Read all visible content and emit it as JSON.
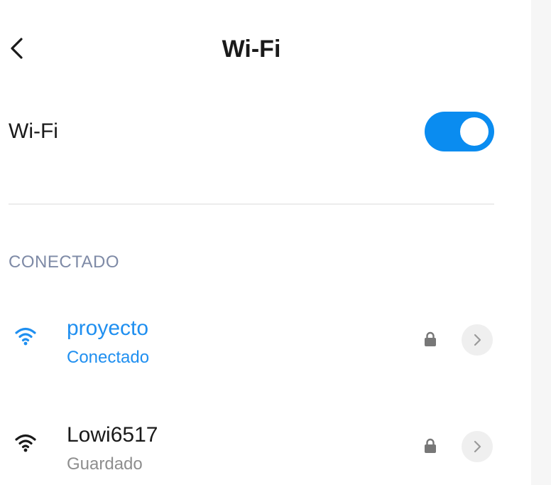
{
  "header": {
    "title": "Wi-Fi",
    "back_icon": "chevron-left-icon"
  },
  "wifi_toggle": {
    "label": "Wi-Fi",
    "enabled": true,
    "accent_color": "#0a8cf0"
  },
  "connected_section": {
    "header": "CONECTADO"
  },
  "networks": [
    {
      "name": "proyecto",
      "status": "Conectado",
      "secured": true,
      "color": "#1f8ff0",
      "signal_icon": "wifi-signal-icon",
      "lock_icon": "lock-icon",
      "detail_icon": "chevron-right-icon"
    },
    {
      "name": "Lowi6517",
      "status": "Guardado",
      "secured": true,
      "color": "#1a1a1a",
      "signal_icon": "wifi-signal-icon",
      "lock_icon": "lock-icon",
      "detail_icon": "chevron-right-icon"
    }
  ]
}
